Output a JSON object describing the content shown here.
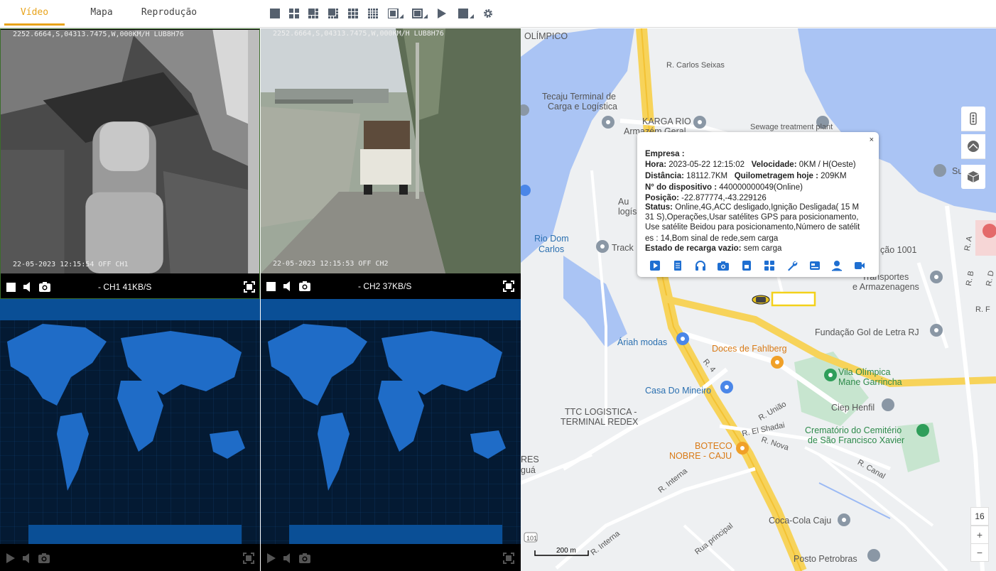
{
  "tabs": [
    {
      "label": "Vídeo",
      "active": true
    },
    {
      "label": "Mapa"
    },
    {
      "label": "Reprodução"
    }
  ],
  "toolbar_icons": [
    "layout-1-icon",
    "layout-4-icon",
    "layout-6-icon",
    "layout-8-icon",
    "layout-9-icon",
    "layout-16-icon",
    "layout-custom-icon",
    "layout-custom2-icon",
    "play-all-icon",
    "stop-all-icon",
    "settings-icon"
  ],
  "colors": {
    "accent": "#e8a31a",
    "map_popup_icon": "#1f6fd1",
    "world_blue": "#2a8cff"
  },
  "video": {
    "ch1": {
      "osd_top": "2252.6664,S,04313.7475,W,000KM/H LUB8H76",
      "osd_bottom": "22-05-2023 12:15:54 OFF CH1",
      "label": "- CH1 41KB/S"
    },
    "ch2": {
      "osd_top": "2252.6664,S,04313.7475,W,000KM/H LUB8H76",
      "osd_bottom": "22-05-2023 12:15:53 OFF CH2",
      "label": "- CH2 37KB/S"
    },
    "controls": [
      "checkbox-icon",
      "volume-icon",
      "snapshot-icon",
      "fullscreen-icon"
    ],
    "bottom_controls": [
      "play-icon",
      "volume-icon",
      "snapshot-icon",
      "fullscreen-icon"
    ]
  },
  "popup": {
    "close": "×",
    "empresa_label": "Empresa :",
    "hora_label": "Hora:",
    "hora": "2023-05-22 12:15:02",
    "velocidade_label": "Velocidade:",
    "velocidade": "0KM / H(Oeste)",
    "distancia_label": "Distância:",
    "distancia": "18112.7KM",
    "quilometragem_label": "Quilometragem hoje :",
    "quilometragem": "209KM",
    "dispositivo_label": "N° do dispositivo :",
    "dispositivo": "440000000049(Online)",
    "posicao_label": "Posição:",
    "posicao": "-22.877774,-43.229126",
    "status_label": "Status:",
    "status_l1": "Online,4G,ACC desligado,Ignição Desligada( 15 M",
    "status_l2": "31 S),Operações,Usar satélites GPS para posicionamento,",
    "status_l3": "Use satélite Beidou para posicionamento,Número de satélit",
    "status_l4": "es : 14,Bom sinal de rede,sem carga",
    "recarga_label": "Estado de recarga vazio:",
    "recarga": "sem carga",
    "action_icons": [
      "video-icon",
      "document-icon",
      "headset-icon",
      "camera-icon",
      "sim-icon",
      "grid-icon",
      "wrench-icon",
      "card-icon",
      "user-pin-icon",
      "video-call-icon"
    ]
  },
  "map": {
    "labels": {
      "olimpico": "OLÍMPICO",
      "carlos_seixas": "R. Carlos Seixas",
      "tecaju1": "Tecaju Terminal de",
      "tecaju2": "Carga e Logística",
      "karga1": "KARGA RIO",
      "karga2": "Armazém Geral",
      "sewage": "Sewage treatment plant",
      "su": "Su",
      "au": "Au",
      "logis": "logís",
      "rio_dom1": "Rio Dom",
      "rio_dom2": "Carlos",
      "track": "Track",
      "cao1001": "ção 1001",
      "transportes1": "Transportes",
      "transportes2": "e Armazenagens",
      "fundacao": "Fundação Gol de Letra RJ",
      "ariah": "Áriah modas",
      "doces": "Doces de Fahlberg",
      "vila1": "Vila Olímpica",
      "vila2": "Mane Garrincha",
      "r4": "R. 4",
      "casa": "Casa Do Mineiro",
      "ciep": "Ciep Henfil",
      "ttc1": "TTC LOGISTICA -",
      "ttc2": "TERMINAL REDEX",
      "runiao": "R. União",
      "rshadai": "R. El Shadai",
      "rnova": "R. Nova",
      "crematorio1": "Crematório do Cemitério",
      "crematorio2": "de São Francisco Xavier",
      "boteco1": "BOTECO",
      "boteco2": "NOBRE - CAJU",
      "res": "RES",
      "gua": "guá",
      "rcanal": "R. Canal",
      "rinterna": "R. Interna",
      "rinterna2": "R. Interna",
      "rprincipal": "Rua principal",
      "cocacola": "Coca-Cola Caju",
      "posto": "Posto Petrobras",
      "ra": "R. A",
      "rb": "R. B",
      "rd": "R. D",
      "rf": "R. F",
      "hwy": "101"
    },
    "scale": "200 m",
    "zoom": "16",
    "zoom_in": "+",
    "zoom_out": "−",
    "side_buttons": [
      "traffic-icon",
      "satellite-icon",
      "3d-cube-icon"
    ]
  }
}
